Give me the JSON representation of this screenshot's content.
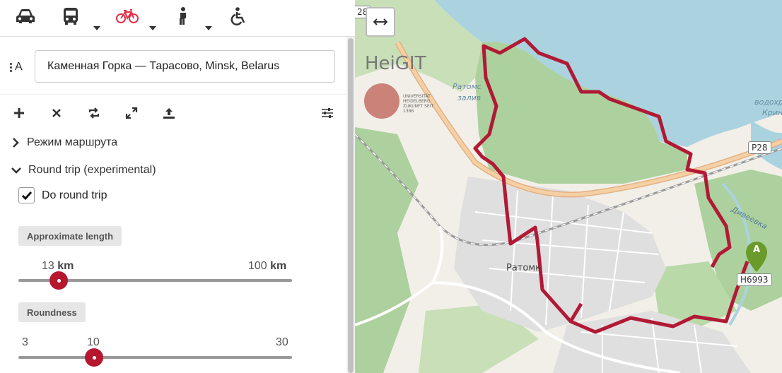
{
  "modes": [
    {
      "name": "car",
      "icon": "car-icon",
      "active": false
    },
    {
      "name": "public-transport",
      "icon": "bus-icon",
      "active": false
    },
    {
      "name": "bike",
      "icon": "bike-icon",
      "active": true
    },
    {
      "name": "foot",
      "icon": "walking-icon",
      "active": false
    },
    {
      "name": "wheelchair",
      "icon": "wheelchair-icon",
      "active": false
    }
  ],
  "search": {
    "marker_label": "A",
    "value": "Каменная Горка — Тарасово, Minsk, Belarus"
  },
  "actions": [
    "add-icon",
    "clear-icon",
    "reverse-icon",
    "fit-icon",
    "upload-icon",
    "settings-icon"
  ],
  "route_mode_label": "Режим маршрута",
  "round_trip_label": "Round trip (experimental)",
  "do_round_trip_label": "Do round trip",
  "do_round_trip_checked": true,
  "length": {
    "label": "Approximate length",
    "min_value": "13",
    "max_value": "100",
    "unit": "km",
    "selected": 13
  },
  "roundness": {
    "label": "Roundness",
    "min": "3",
    "value": "10",
    "max": "30",
    "selected": 10
  },
  "map": {
    "heigit_logo": "HeiGIT",
    "heigit_sub": "UNIVERSITÄT HEIDELBERG ZUKUNFT SEIT 1386",
    "toggle_icon": "expand-horizontal-icon",
    "labels": {
      "water1": "Ратомс",
      "water2": "залив",
      "town": "Ратомк",
      "river": "Дивеевка",
      "reservoir1": "водохра",
      "reservoir2": "Крин",
      "road_p28": "P28",
      "road_p28_left": "28",
      "road_h": "Н6993"
    },
    "marker_label": "A",
    "colors": {
      "route": "#b01a35",
      "water": "#aad3df",
      "forest": "#add19e",
      "marker": "#6a9a2a"
    }
  }
}
